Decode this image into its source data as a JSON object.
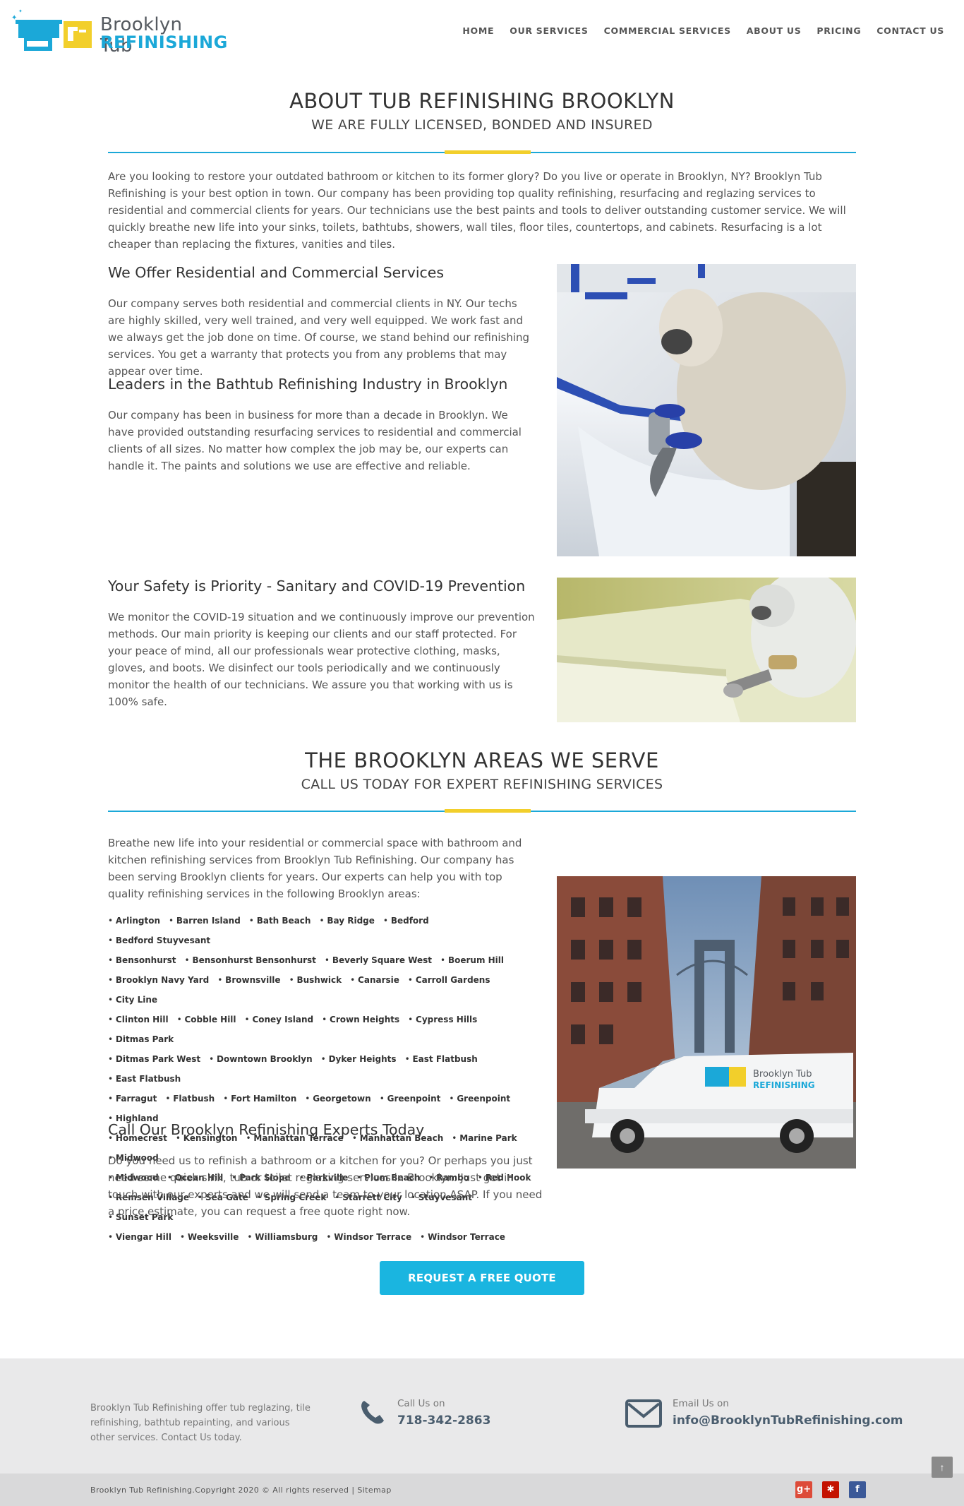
{
  "header": {
    "logo": {
      "line1": "Brooklyn Tub",
      "line2": "REFINISHING"
    },
    "nav": [
      "HOME",
      "OUR SERVICES",
      "COMMERCIAL SERVICES",
      "ABOUT US",
      "PRICING",
      "CONTACT US"
    ]
  },
  "about": {
    "title": "ABOUT TUB REFINISHING BROOKLYN",
    "subtitle": "WE ARE FULLY LICENSED, BONDED AND INSURED",
    "intro": "Are you looking to restore your outdated bathroom or kitchen to its former glory? Do you live or operate in Brooklyn, NY? Brooklyn Tub Refinishing is your best option in town. Our company has been providing top quality refinishing, resurfacing and reglazing services to residential and commercial clients for years. Our technicians use the best paints and tools to deliver outstanding customer service. We will quickly breathe new life into your sinks, toilets, bathtubs, showers, wall tiles, floor tiles, countertops, and cabinets. Resurfacing is a lot cheaper than replacing the fixtures, vanities and tiles.",
    "h_residential": "We Offer Residential and Commercial Services",
    "p_residential": "Our company serves both residential and commercial clients in NY. Our techs are highly skilled, very well trained, and very well equipped. We work fast and we always get the job done on time. Of course, we stand behind our refinishing services. You get a warranty that protects you from any problems that may appear over time.",
    "h_leaders": "Leaders in the Bathtub Refinishing Industry in Brooklyn",
    "p_leaders": "Our company has been in business for more than a decade in Brooklyn. We have provided outstanding resurfacing services to residential and commercial clients of all sizes. No matter how complex the job may be, our experts can handle it. The paints and solutions we use are effective and reliable.",
    "h_safety": "Your Safety is Priority - Sanitary and COVID-19 Prevention",
    "p_safety": "We monitor the COVID-19 situation and we continuously improve our prevention methods. Our main priority is keeping our clients and our staff protected. For your peace of mind, all our professionals wear protective clothing, masks, gloves, and boots. We disinfect our tools periodically and we continuously monitor the health of our technicians. We assure you that working with us is 100% safe."
  },
  "areas": {
    "title": "THE BROOKLYN AREAS WE SERVE",
    "subtitle": "CALL US TODAY FOR EXPERT REFINISHING SERVICES",
    "intro": "Breathe new life into your residential or commercial space with bathroom and kitchen refinishing services from Brooklyn Tub Refinishing. Our company has been serving Brooklyn clients for years. Our experts can help you with top quality refinishing services in the following Brooklyn areas:",
    "rows": [
      [
        "Arlington",
        "Barren Island",
        "Bath Beach",
        "Bay Ridge",
        "Bedford",
        "Bedford Stuyvesant"
      ],
      [
        "Bensonhurst",
        "Bensonhurst  Bensonhurst",
        "Beverly Square West",
        "Boerum Hill"
      ],
      [
        "Brooklyn Navy Yard",
        "Brownsville",
        "Bushwick",
        "Canarsie",
        "Carroll Gardens",
        "City Line"
      ],
      [
        "Clinton Hill",
        "Cobble Hill",
        "Coney Island",
        "Crown Heights",
        "Cypress Hills",
        "Ditmas Park"
      ],
      [
        "Ditmas Park West",
        "Downtown Brooklyn",
        "Dyker Heights",
        "East Flatbush",
        "East Flatbush"
      ],
      [
        "Farragut",
        "Flatbush",
        "Fort Hamilton",
        "Georgetown",
        "Greenpoint",
        "Greenpoint",
        "Highland"
      ],
      [
        "Homecrest",
        "Kensington",
        "Manhattan Terrace",
        "Manhattan Beach",
        "Marine Park",
        "Midwood"
      ],
      [
        "Midwood",
        "Ocean Hill",
        "Park Slope",
        "Parkville",
        "Plum Beach",
        "Rambo",
        "Red Hook"
      ],
      [
        "Remsen Village",
        "Sea Gate",
        "Spring Creek",
        "Starrett City",
        "Stuyvesant",
        "Sunset Park"
      ],
      [
        "Viengar Hill",
        "Weeksville",
        "Williamsburg",
        "Windsor Terrace",
        "Windsor Terrace"
      ]
    ],
    "h_call": "Call Our Brooklyn Refinishing Experts Today",
    "p_call": "Do you need us to refinish a bathroom or a kitchen for you? Or perhaps you just need some quick sink, tub or toilet reglazing services in Brooklyn. Just get in touch with our experts and we will send a team to your location ASAP. If you need a price estimate, you can request a free quote right now.",
    "van_logo1": "Brooklyn Tub",
    "van_logo2": "REFINISHING"
  },
  "cta": {
    "label": "REQUEST A FREE QUOTE"
  },
  "footer": {
    "about": "Brooklyn Tub Refinishing offer tub reglazing, tile refinishing, bathtub repainting, and various other services. Contact Us today.",
    "call_label": "Call Us on",
    "phone": "718-342-2863",
    "email_label": "Email Us on",
    "email": "info@BrooklynTubRefinishing.com",
    "copyright": "Brooklyn Tub Refinishing.Copyright 2020 © All rights reserved | Sitemap",
    "social": [
      "google-plus-icon",
      "yelp-icon",
      "facebook-icon"
    ]
  },
  "colors": {
    "accent": "#1ba8d8",
    "yellow": "#f2cf2b",
    "cta": "#1ab5e0"
  }
}
